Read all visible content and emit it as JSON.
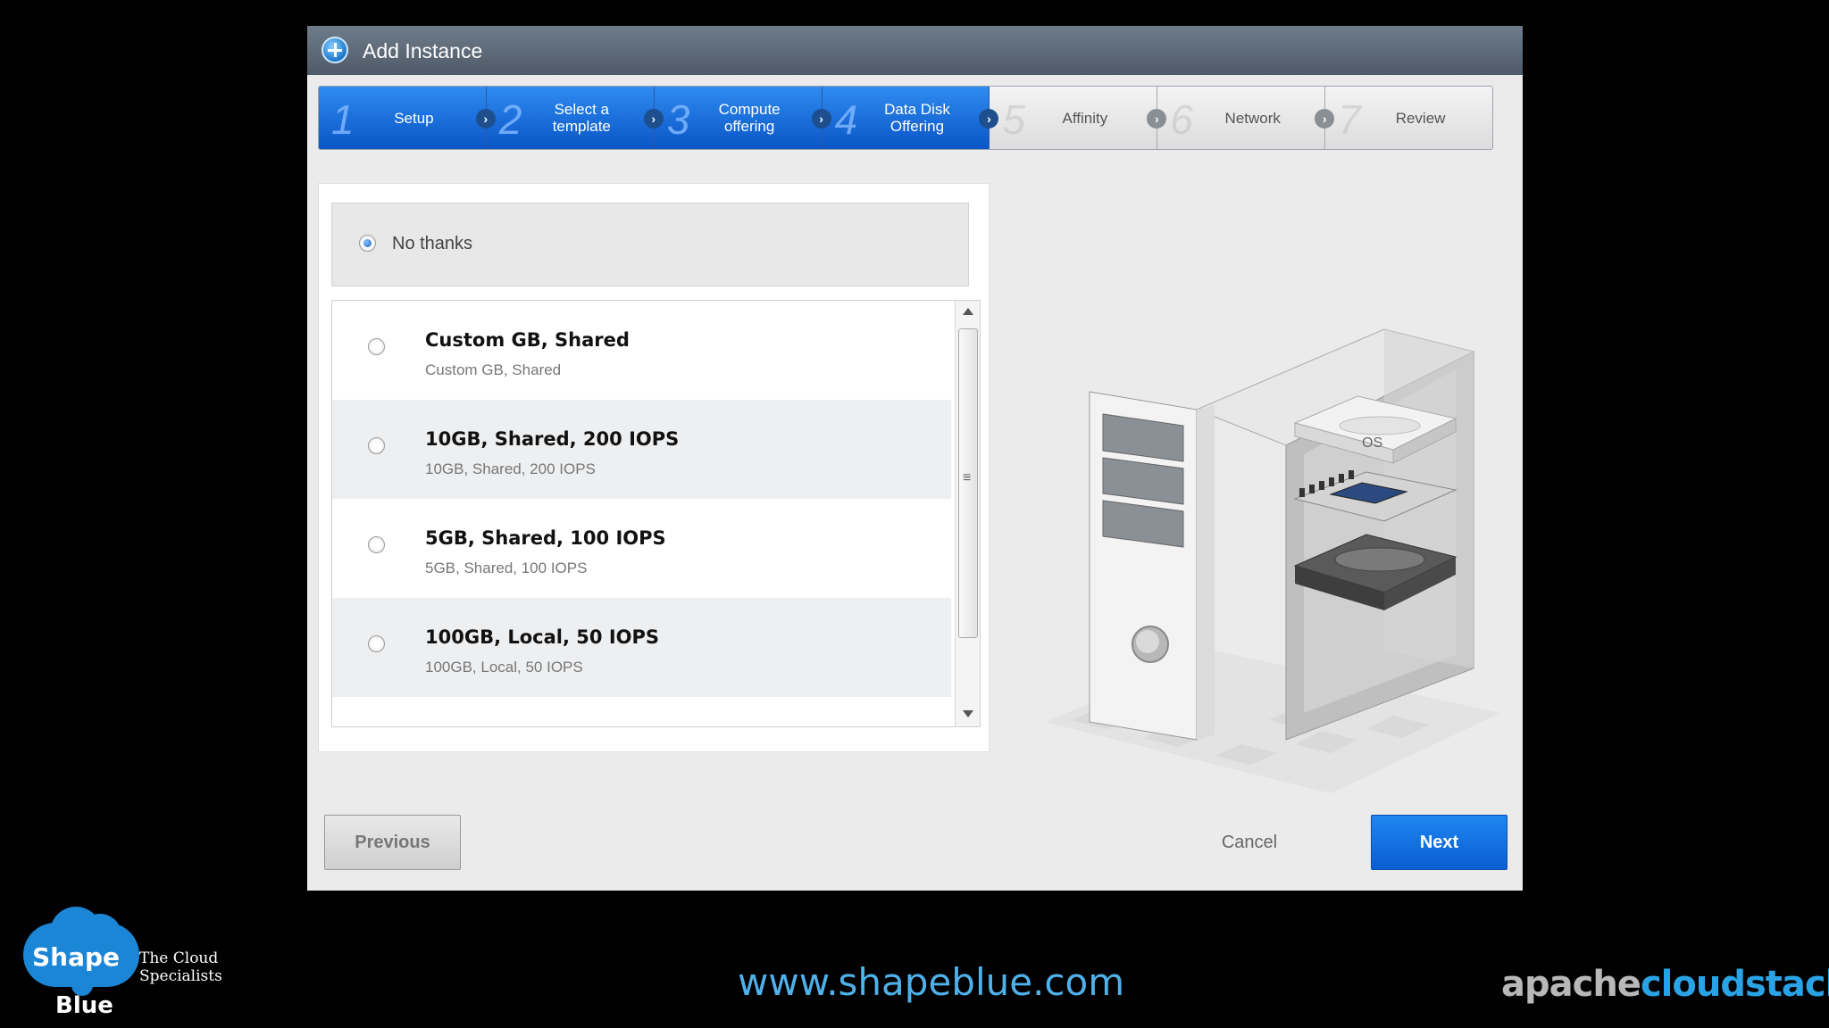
{
  "dialog": {
    "title": "Add Instance",
    "title_icon": "add-circle-icon"
  },
  "steps": [
    {
      "number": "1",
      "label": "Setup",
      "state": "active"
    },
    {
      "number": "2",
      "label": "Select a\ntemplate",
      "state": "active"
    },
    {
      "number": "3",
      "label": "Compute\noffering",
      "state": "active"
    },
    {
      "number": "4",
      "label": "Data Disk\nOffering",
      "state": "active"
    },
    {
      "number": "5",
      "label": "Affinity",
      "state": "inactive"
    },
    {
      "number": "6",
      "label": "Network",
      "state": "inactive"
    },
    {
      "number": "7",
      "label": "Review",
      "state": "inactive"
    }
  ],
  "no_thanks": {
    "label": "No thanks",
    "selected": true
  },
  "offerings": [
    {
      "name": "Custom GB, Shared",
      "description": "Custom GB, Shared"
    },
    {
      "name": "10GB, Shared, 200 IOPS",
      "description": "10GB, Shared, 200 IOPS"
    },
    {
      "name": "5GB, Shared, 100 IOPS",
      "description": "5GB, Shared, 100 IOPS"
    },
    {
      "name": "100GB, Local, 50 IOPS",
      "description": "100GB, Local, 50 IOPS"
    }
  ],
  "illustration": {
    "os_label": "OS"
  },
  "buttons": {
    "previous": "Previous",
    "cancel": "Cancel",
    "next": "Next"
  },
  "footer": {
    "logo_word1": "Shape",
    "logo_word2": "Blue",
    "logo_tagline": "The Cloud Specialists",
    "website": "www.shapeblue.com",
    "brand_part1": "apache",
    "brand_part2": "cloudstack",
    "brand_tm": "™"
  },
  "colors": {
    "accent_blue": "#0b5ed0",
    "website_blue": "#4fb0ea",
    "brand_blue": "#2aa3e6"
  }
}
